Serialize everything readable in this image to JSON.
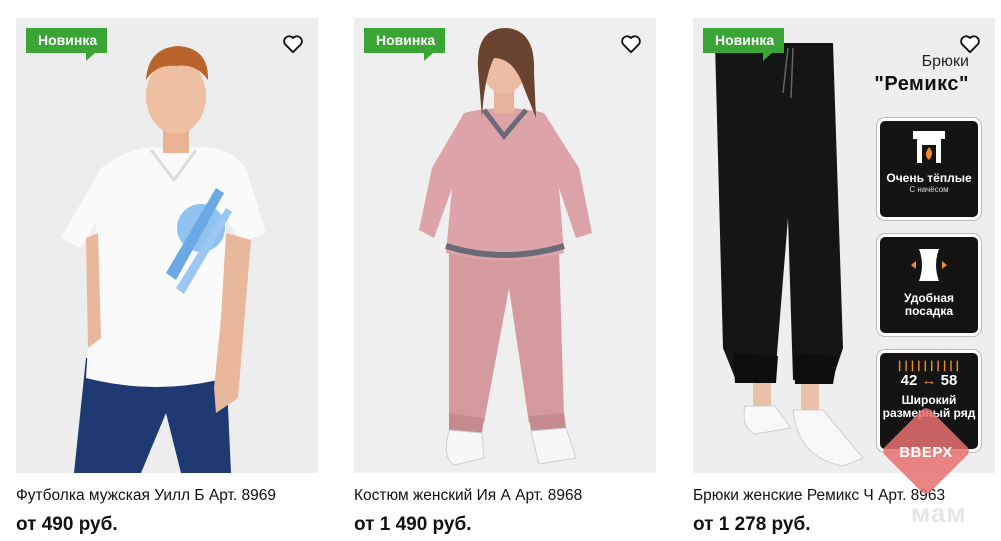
{
  "products": [
    {
      "badge": "Новинка",
      "title": "Футболка мужская Уилл Б Арт. 8969",
      "price": "от 490 руб."
    },
    {
      "badge": "Новинка",
      "title": "Костюм женский Ия А Арт. 8968",
      "price": "от 1 490 руб."
    },
    {
      "badge": "Новинка",
      "title": "Брюки женские Ремикс Ч Арт. 8963",
      "price": "от 1 278 руб.",
      "promo": {
        "line1": "Брюки",
        "line2": "\"Ремикс\"",
        "feature1_title": "Очень тёплые",
        "feature1_sub": "С начёсом",
        "feature2_title": "Удобная посадка",
        "feature3_range_from": "42",
        "feature3_range_to": "58",
        "feature3_title": "Широкий размерный ряд"
      }
    }
  ],
  "scroll_up": {
    "label": "ВВЕРХ"
  },
  "watermark": "мам",
  "colors": {
    "badge": "#3aa535",
    "up_button": "#e76e6e"
  },
  "icons": {
    "favorite": "heart-icon"
  }
}
